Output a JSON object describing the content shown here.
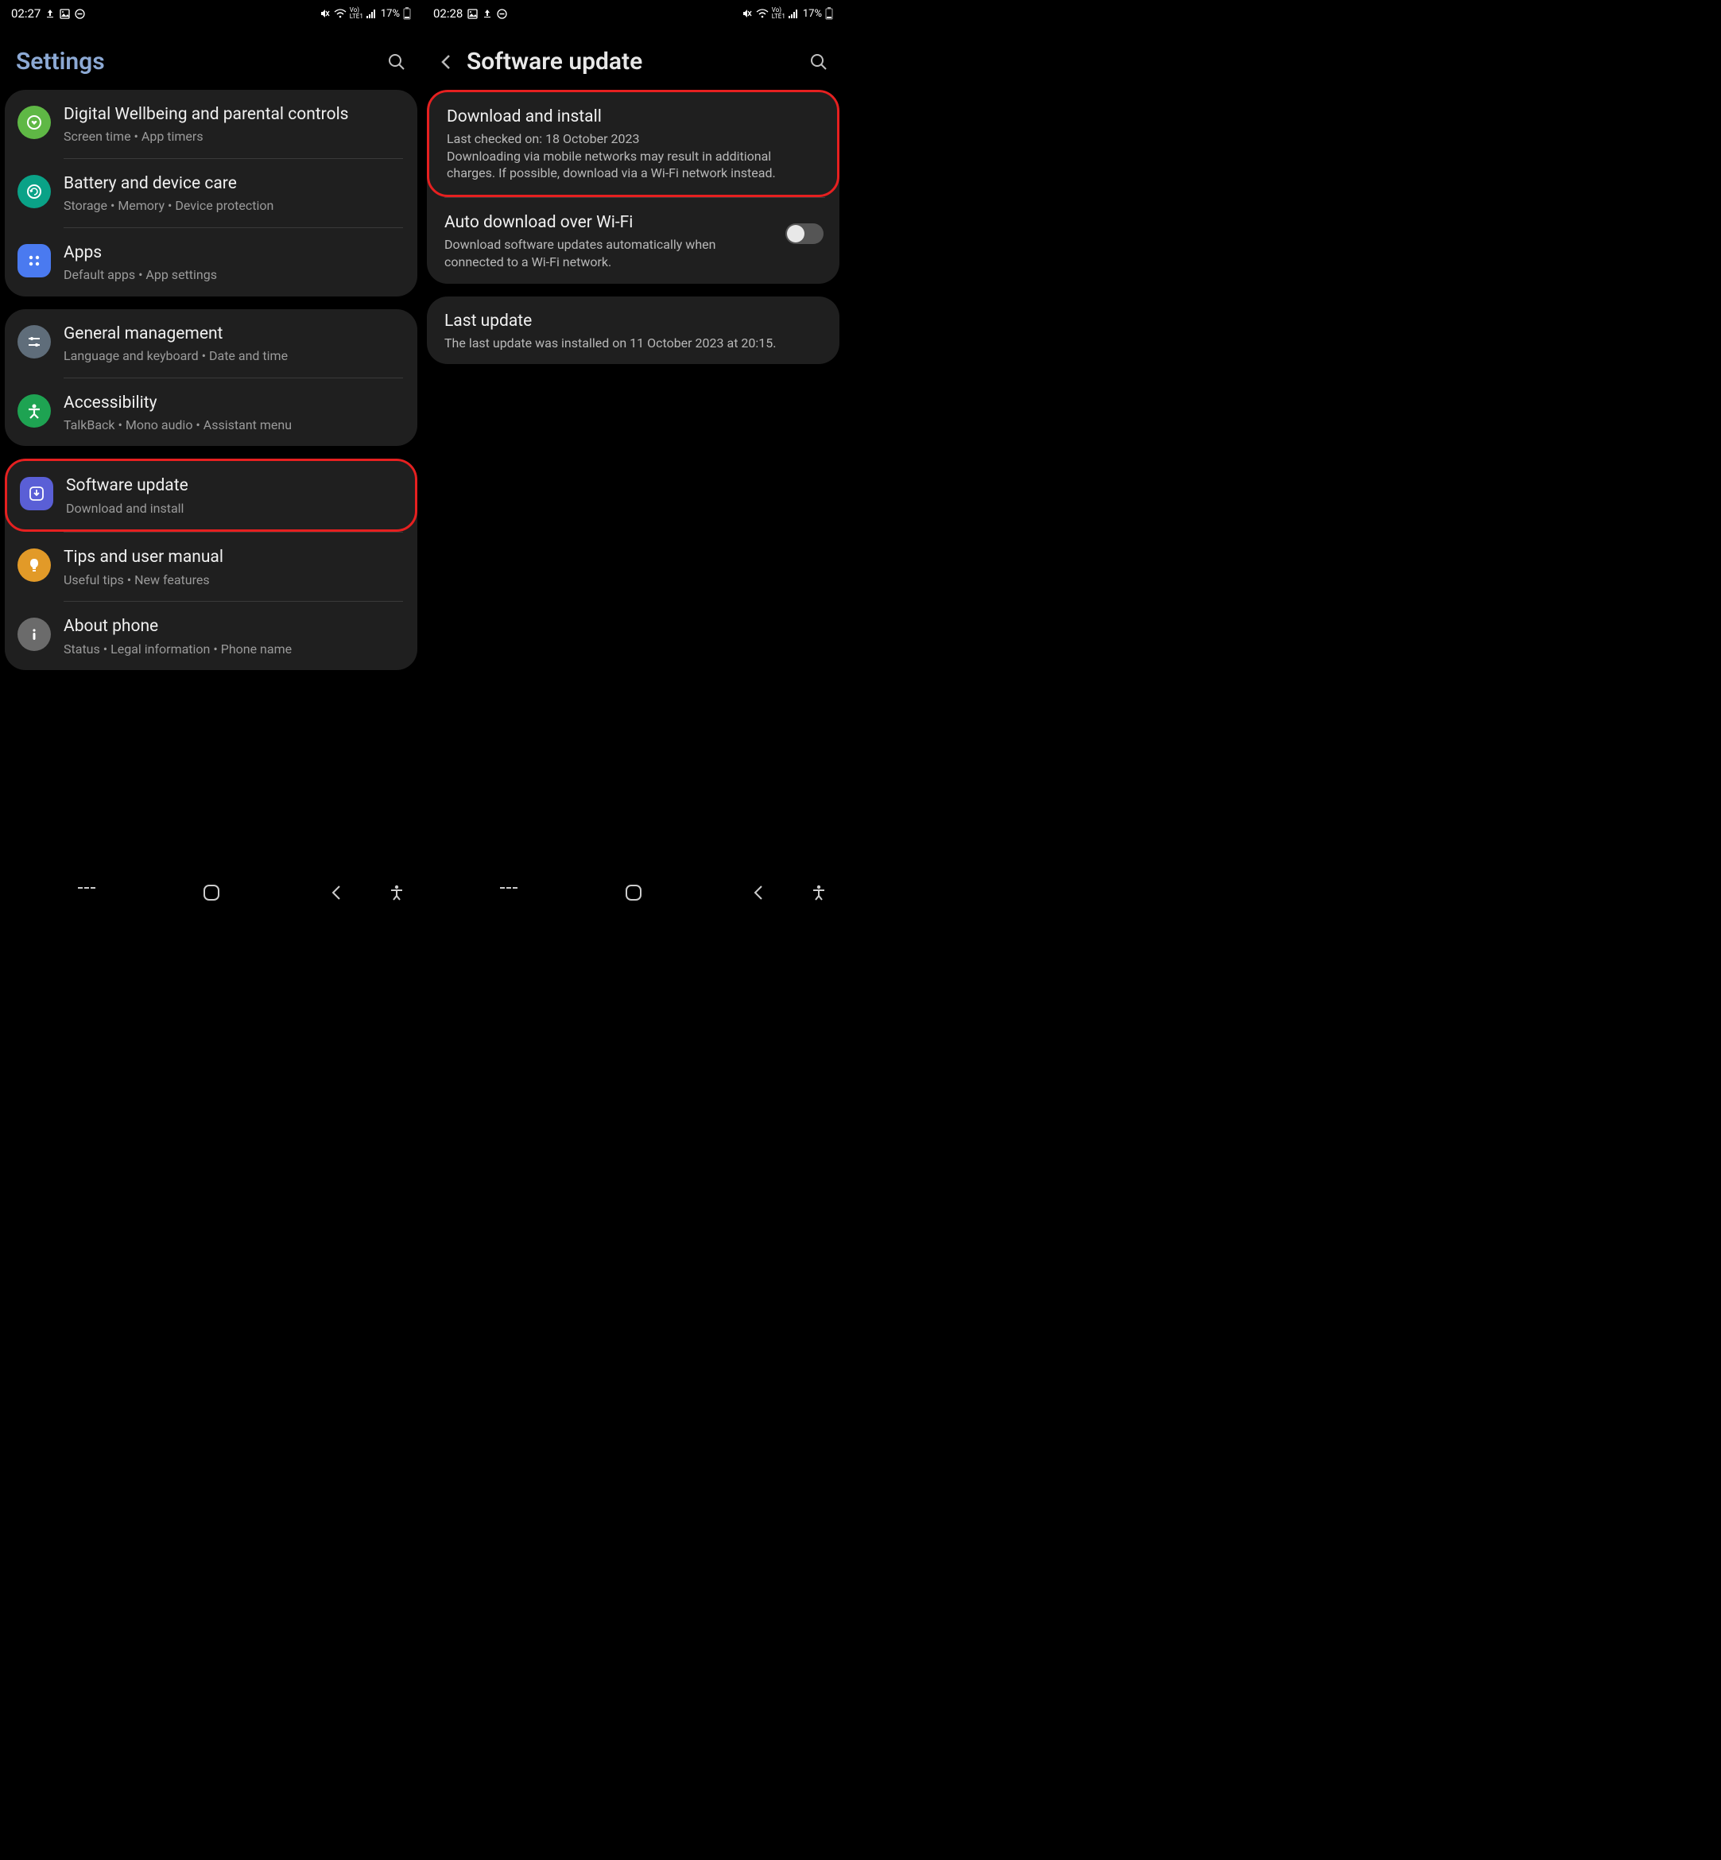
{
  "left": {
    "status": {
      "time": "02:27",
      "battery": "17%"
    },
    "title": "Settings",
    "groups": [
      {
        "items": [
          {
            "id": "wellbeing",
            "title": "Digital Wellbeing and parental controls",
            "sub": "Screen time  •  App timers",
            "iconBg": "#5fb845",
            "icon": "heart-ring"
          },
          {
            "id": "battery",
            "title": "Battery and device care",
            "sub": "Storage  •  Memory  •  Device protection",
            "iconBg": "#0aa287",
            "icon": "refresh-ring"
          },
          {
            "id": "apps",
            "title": "Apps",
            "sub": "Default apps  •  App settings",
            "iconBg": "#4a7af0",
            "icon": "dots"
          }
        ]
      },
      {
        "items": [
          {
            "id": "general",
            "title": "General management",
            "sub": "Language and keyboard  •  Date and time",
            "iconBg": "#5f6d7a",
            "icon": "sliders"
          },
          {
            "id": "accessibility",
            "title": "Accessibility",
            "sub": "TalkBack  •  Mono audio  •  Assistant menu",
            "iconBg": "#1ea352",
            "icon": "person"
          }
        ]
      },
      {
        "highlight": 0,
        "items": [
          {
            "id": "swupdate",
            "title": "Software update",
            "sub": "Download and install",
            "iconBg": "#5a5fd6",
            "icon": "download-ring"
          },
          {
            "id": "tips",
            "title": "Tips and user manual",
            "sub": "Useful tips  •  New features",
            "iconBg": "#e29a28",
            "icon": "bulb"
          },
          {
            "id": "about",
            "title": "About phone",
            "sub": "Status  •  Legal information  •  Phone name",
            "iconBg": "#6b6b6b",
            "icon": "info"
          }
        ]
      }
    ]
  },
  "right": {
    "status": {
      "time": "02:28",
      "battery": "17%"
    },
    "title": "Software update",
    "sections": [
      {
        "items": [
          {
            "id": "download",
            "title": "Download and install",
            "sub": "Last checked on: 18 October 2023\nDownloading via mobile networks may result in additional charges. If possible, download via a Wi-Fi network instead.",
            "highlight": true
          },
          {
            "id": "autodl",
            "title": "Auto download over Wi-Fi",
            "sub": "Download software updates automatically when connected to a Wi-Fi network.",
            "toggle": false
          }
        ]
      },
      {
        "items": [
          {
            "id": "last",
            "title": "Last update",
            "sub": "The last update was installed on 11 October 2023 at 20:15."
          }
        ]
      }
    ]
  }
}
